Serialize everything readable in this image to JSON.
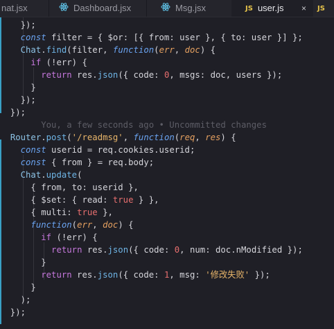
{
  "tabs": [
    {
      "label": "nat.jsx",
      "icon": "react-icon",
      "active": false
    },
    {
      "label": "Dashboard.jsx",
      "icon": "react-icon",
      "active": false
    },
    {
      "label": "Msg.jsx",
      "icon": "react-icon",
      "active": false
    },
    {
      "label": "user.js",
      "icon": "js-icon",
      "icon_text": "JS",
      "active": true,
      "close": "×"
    },
    {
      "label": "",
      "icon": "js-icon",
      "icon_text": "JS",
      "active": false
    }
  ],
  "colors": {
    "background": "#1f1f26",
    "keyword": "#6aa3f0",
    "function": "#6fb5e6",
    "string": "#e8b56a",
    "number": "#e86f6f",
    "param": "#e5a060",
    "gutter_modified": "#3aa0c6",
    "blame": "#5d5d66"
  },
  "code": [
    [
      [
        "p",
        "    });"
      ]
    ],
    [
      [
        "p",
        "    "
      ],
      [
        "kw",
        "const"
      ],
      [
        "p",
        " filter = { $or: [{ from: user }, { to: user }] };"
      ]
    ],
    [
      [
        "p",
        "    "
      ],
      [
        "cls",
        "Chat"
      ],
      [
        "p",
        "."
      ],
      [
        "fn",
        "find"
      ],
      [
        "p",
        "(filter, "
      ],
      [
        "kw",
        "function"
      ],
      [
        "p",
        "("
      ],
      [
        "param",
        "err"
      ],
      [
        "p",
        ", "
      ],
      [
        "param",
        "doc"
      ],
      [
        "p",
        ") {"
      ]
    ],
    [
      [
        "p",
        "      "
      ],
      [
        "kw2",
        "if"
      ],
      [
        "p",
        " (!err) {"
      ]
    ],
    [
      [
        "p",
        "        "
      ],
      [
        "kw2",
        "return"
      ],
      [
        "p",
        " res."
      ],
      [
        "fn",
        "json"
      ],
      [
        "p",
        "({ code: "
      ],
      [
        "num",
        "0"
      ],
      [
        "p",
        ", msgs: doc, users });"
      ]
    ],
    [
      [
        "p",
        "      }"
      ]
    ],
    [
      [
        "p",
        "    });"
      ]
    ],
    [
      [
        "p",
        "  });"
      ]
    ],
    [
      [
        "blame",
        "        You, a few seconds ago • Uncommitted changes"
      ]
    ],
    [
      [
        "p",
        "  "
      ],
      [
        "cls",
        "Router"
      ],
      [
        "p",
        "."
      ],
      [
        "fn",
        "post"
      ],
      [
        "p",
        "("
      ],
      [
        "str",
        "'/readmsg'"
      ],
      [
        "p",
        ", "
      ],
      [
        "kw",
        "function"
      ],
      [
        "p",
        "("
      ],
      [
        "param",
        "req"
      ],
      [
        "p",
        ", "
      ],
      [
        "param",
        "res"
      ],
      [
        "p",
        ") {"
      ]
    ],
    [
      [
        "p",
        "    "
      ],
      [
        "kw",
        "const"
      ],
      [
        "p",
        " userid = req.cookies.userid;"
      ]
    ],
    [
      [
        "p",
        "    "
      ],
      [
        "kw",
        "const"
      ],
      [
        "p",
        " { from } = req.body;"
      ]
    ],
    [
      [
        "p",
        "    "
      ],
      [
        "cls",
        "Chat"
      ],
      [
        "p",
        "."
      ],
      [
        "fn",
        "update"
      ],
      [
        "p",
        "("
      ]
    ],
    [
      [
        "p",
        "      { from, to: userid },"
      ]
    ],
    [
      [
        "p",
        "      { $set: { read: "
      ],
      [
        "bool",
        "true"
      ],
      [
        "p",
        " } },"
      ]
    ],
    [
      [
        "p",
        "      { multi: "
      ],
      [
        "bool",
        "true"
      ],
      [
        "p",
        " },"
      ]
    ],
    [
      [
        "p",
        "      "
      ],
      [
        "kw",
        "function"
      ],
      [
        "p",
        "("
      ],
      [
        "param",
        "err"
      ],
      [
        "p",
        ", "
      ],
      [
        "param",
        "doc"
      ],
      [
        "p",
        ") {"
      ]
    ],
    [
      [
        "p",
        "        "
      ],
      [
        "kw2",
        "if"
      ],
      [
        "p",
        " (!err) {"
      ]
    ],
    [
      [
        "p",
        "          "
      ],
      [
        "kw2",
        "return"
      ],
      [
        "p",
        " res."
      ],
      [
        "fn",
        "json"
      ],
      [
        "p",
        "({ code: "
      ],
      [
        "num",
        "0"
      ],
      [
        "p",
        ", num: doc.nModified });"
      ]
    ],
    [
      [
        "p",
        "        }"
      ]
    ],
    [
      [
        "p",
        "        "
      ],
      [
        "kw2",
        "return"
      ],
      [
        "p",
        " res."
      ],
      [
        "fn",
        "json"
      ],
      [
        "p",
        "({ code: "
      ],
      [
        "num",
        "1"
      ],
      [
        "p",
        ", msg: "
      ],
      [
        "str",
        "'修改失败'"
      ],
      [
        "p",
        " });"
      ]
    ],
    [
      [
        "p",
        "      }"
      ]
    ],
    [
      [
        "p",
        "    );"
      ]
    ],
    [
      [
        "p",
        "  });"
      ]
    ]
  ]
}
